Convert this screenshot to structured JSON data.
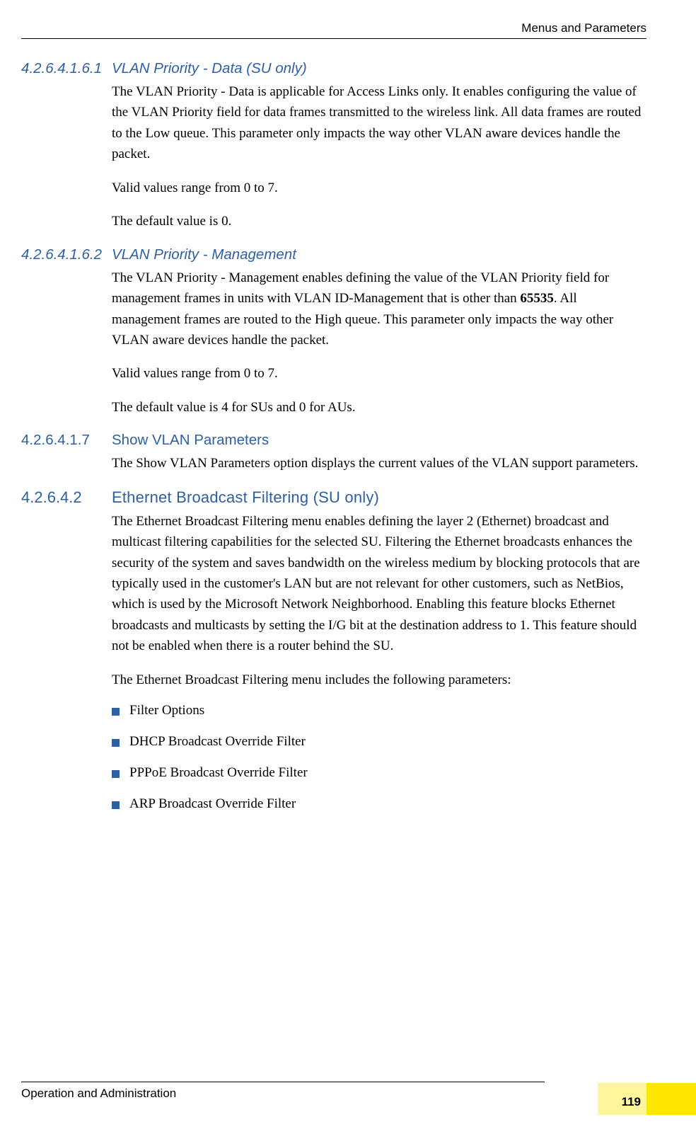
{
  "header": {
    "right": "Menus and Parameters"
  },
  "sections": [
    {
      "num": "4.2.6.4.1.6.1",
      "title": "VLAN Priority - Data (SU only)",
      "style": "h4",
      "paras": [
        {
          "text": "The VLAN Priority - Data is applicable for Access Links only. It enables configuring the value of the VLAN Priority field for data frames transmitted to the wireless link. All data frames are routed to the Low queue. This parameter only impacts the way other VLAN aware devices handle the packet."
        },
        {
          "text": "Valid values range from 0 to 7."
        },
        {
          "text": "The default value is 0."
        }
      ]
    },
    {
      "num": "4.2.6.4.1.6.2",
      "title": "VLAN Priority - Management",
      "style": "h4",
      "paras": [
        {
          "text_pre": "The VLAN Priority - Management enables defining the value of the VLAN Priority field for management frames in units with VLAN ID-Management that is other than ",
          "bold": "65535",
          "text_post": ". All management frames are routed to the High queue. This parameter only impacts the way other VLAN aware devices handle the packet."
        },
        {
          "text": "Valid values range from 0 to 7."
        },
        {
          "text": "The default value is 4 for SUs and 0 for AUs."
        }
      ]
    },
    {
      "num": "4.2.6.4.1.7",
      "title": "Show VLAN Parameters",
      "style": "h3",
      "paras": [
        {
          "text": "The Show VLAN Parameters option displays the current values of the VLAN support parameters."
        }
      ]
    },
    {
      "num": "4.2.6.4.2",
      "title": "Ethernet Broadcast Filtering (SU only)",
      "style": "h2",
      "paras": [
        {
          "text": "The Ethernet Broadcast Filtering menu enables defining the layer 2 (Ethernet) broadcast and multicast filtering capabilities for the selected SU. Filtering the Ethernet broadcasts enhances the security of the system and saves bandwidth on the wireless medium by blocking protocols that are typically used in the customer's LAN but are not relevant for other customers, such as NetBios, which is used by the Microsoft Network Neighborhood. Enabling this feature blocks Ethernet broadcasts and multicasts by setting the I/G bit at the destination address to 1. This feature should not be enabled when there is a router behind the SU."
        },
        {
          "text": "The Ethernet Broadcast Filtering menu includes the following parameters:"
        }
      ],
      "bullets": [
        "Filter Options",
        "DHCP Broadcast Override Filter",
        "PPPoE Broadcast Override Filter",
        "ARP Broadcast Override Filter"
      ]
    }
  ],
  "footer": {
    "left": "Operation and Administration",
    "page": "119"
  }
}
